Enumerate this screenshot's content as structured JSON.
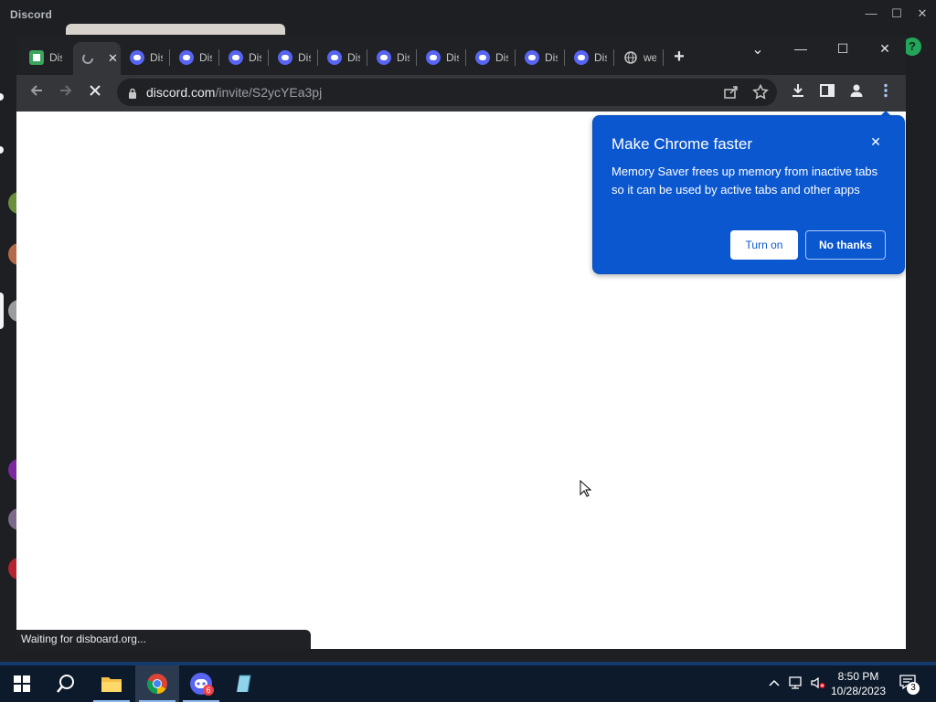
{
  "discord": {
    "title": "Discord",
    "controls": {
      "minimize": "—",
      "maximize": "☐",
      "close": "✕"
    },
    "help": "?"
  },
  "chrome": {
    "tabs": [
      {
        "label": "Dis",
        "icon": "disboard-favicon-icon"
      },
      {
        "label": "",
        "icon": "loading-spinner-icon",
        "active": true,
        "close": "✕"
      },
      {
        "label": "Dis",
        "icon": "discord-icon"
      },
      {
        "label": "Dis",
        "icon": "discord-icon"
      },
      {
        "label": "Dis",
        "icon": "discord-icon"
      },
      {
        "label": "Dis",
        "icon": "discord-icon"
      },
      {
        "label": "Dis",
        "icon": "discord-icon"
      },
      {
        "label": "Dis",
        "icon": "discord-icon"
      },
      {
        "label": "Dis",
        "icon": "discord-icon"
      },
      {
        "label": "Dis",
        "icon": "discord-icon"
      },
      {
        "label": "Dis",
        "icon": "discord-icon"
      },
      {
        "label": "Dis",
        "icon": "discord-icon"
      },
      {
        "label": "we",
        "icon": "globe-icon"
      }
    ],
    "new_tab": "+",
    "window_controls": {
      "tab_search": "⌄",
      "minimize": "—",
      "maximize": "☐",
      "close": "✕"
    },
    "url": {
      "host": "discord.com",
      "path": "/invite/S2ycYEa3pj"
    },
    "status": "Waiting for disboard.org..."
  },
  "popup": {
    "title": "Make Chrome faster",
    "body": "Memory Saver frees up memory from inactive tabs so it can be used by active tabs and other apps",
    "turn_on": "Turn on",
    "no_thanks": "No thanks",
    "close": "✕"
  },
  "taskbar": {
    "time": "8:50 PM",
    "date": "10/28/2023",
    "discord_badge": "6",
    "notifications": "3"
  },
  "colors": {
    "popup_blue": "#0b57d0",
    "chrome_dark": "#202124",
    "discord_bg": "#1e1f22"
  }
}
